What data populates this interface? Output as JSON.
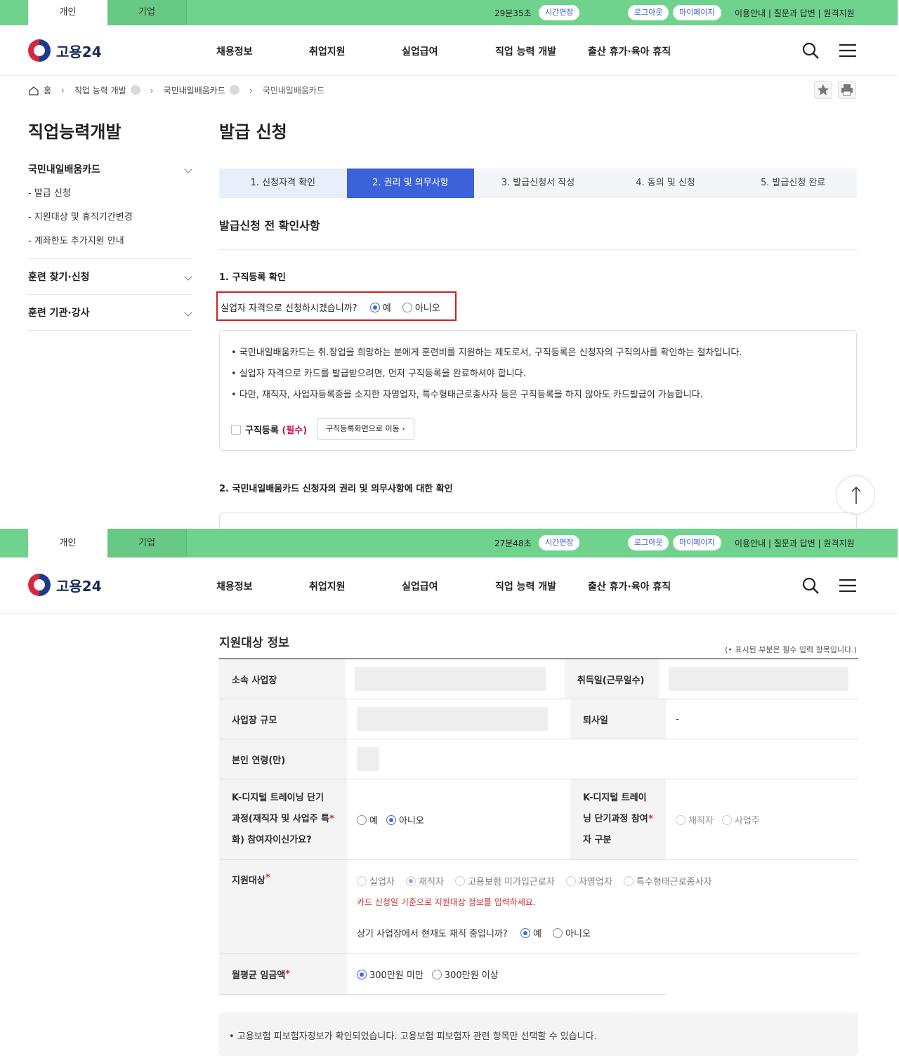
{
  "topbar_1": {
    "tab_personal": "개인",
    "tab_company": "기업",
    "timer": "29분35초",
    "extend": "시간연장",
    "logout": "로그아웃",
    "mypage": "마이페이지",
    "util": "이용안내 | 질문과 답변 | 원격지원"
  },
  "topbar_2": {
    "tab_personal": "개인",
    "tab_company": "기업",
    "timer": "27분48초",
    "extend": "시간연장",
    "logout": "로그아웃",
    "mypage": "마이페이지",
    "util": "이용안내 | 질문과 답변 | 원격지원"
  },
  "header": {
    "logo_text": "고용24",
    "nav": [
      "채용정보",
      "취업지원",
      "실업급여",
      "직업 능력 개발",
      "출산 휴가·육아 휴직"
    ]
  },
  "breadcrumb": {
    "home": "홈",
    "level1": "직업 능력 개발",
    "level2": "국민내일배움카드",
    "level3": "국민내일배움카드"
  },
  "sidebar": {
    "title": "직업능력개발",
    "groups": [
      {
        "label": "국민내일배움카드",
        "items": [
          "- 발급 신청",
          "- 지원대상 및 휴직기간변경",
          "- 계좌한도 추가지원 안내"
        ]
      },
      {
        "label": "훈련 찾기·신청"
      },
      {
        "label": "훈련 기관·강사"
      }
    ]
  },
  "page_title": "발급 신청",
  "steps": [
    "1. 신청자격 확인",
    "2. 권리 및 의무사항",
    "3. 발급신청서 작성",
    "4. 동의 및 신청",
    "5. 발급신청 완료"
  ],
  "section1": {
    "title": "발급신청 전 확인사항",
    "sub": "1. 구직등록 확인",
    "question": "실업자 자격으로 신청하시겠습니까?",
    "yes": "예",
    "no": "아니오",
    "lines": [
      "• 국민내일배움카드는 취.창업을 희망하는 분에게 훈련비를 지원하는 제도로서, 구직등록은 신청자의 구직의사를 확인하는 절차입니다.",
      "• 실업자 자격으로 카드를 발급받으려면, 먼저 구직등록을 완료하셔야 합니다.",
      "• 다만, 재직자, 사업자등록증을 소지한 자영업자, 특수형태근로종사자 등은 구직등록을 하지 않아도 카드발급이 가능합니다."
    ],
    "check_label": "구직등록",
    "check_req": "(필수)",
    "go_button": "구직등록화면으로 이동"
  },
  "section2_title": "2. 국민내일배움카드 신청자의 권리 및 의무사항에 대한 확인",
  "support": {
    "title": "지원대상 정보",
    "legend_pre": "(",
    "legend_star": "•",
    "legend_post": " 표시된 부분은 필수 입력 항목입니다.)",
    "workplace_label": "소속 사업장",
    "hire_date_label": "취득일(근무일수)",
    "size_label": "사업장 규모",
    "resign_label": "퇴사일",
    "resign_value": "-",
    "age_label": "본인 연령(만)",
    "kdigital_q_label": "K-디지털 트레이닝 단기과정(재직자 및 사업주 특화) 참여자이신가요?",
    "kdigital_yes": "예",
    "kdigital_no": "아니오",
    "kdigital_type_label": "K-디지털 트레이닝 단기과정 참여자 구분",
    "kdigital_type_opts": [
      "재직자",
      "사업주"
    ],
    "target_label": "지원대상",
    "target_opts": [
      "실업자",
      "재직자",
      "고용보험 미가입근로자",
      "자영업자",
      "특수형태근로종사자"
    ],
    "target_hint": "카드 신청일 기준으로 지원대상 정보를 입력하세요.",
    "still_working_q": "상기 사업장에서 현재도 재직 중입니까?",
    "still_yes": "예",
    "still_no": "아니오",
    "wage_label": "월평균 임금액",
    "wage_opts": [
      "300만원 미만",
      "300만원 이상"
    ],
    "notice": "• 고용보험 피보험자정보가 확인되었습니다. 고용보험 피보험자 관련 항목만 선택할 수 있습니다."
  }
}
